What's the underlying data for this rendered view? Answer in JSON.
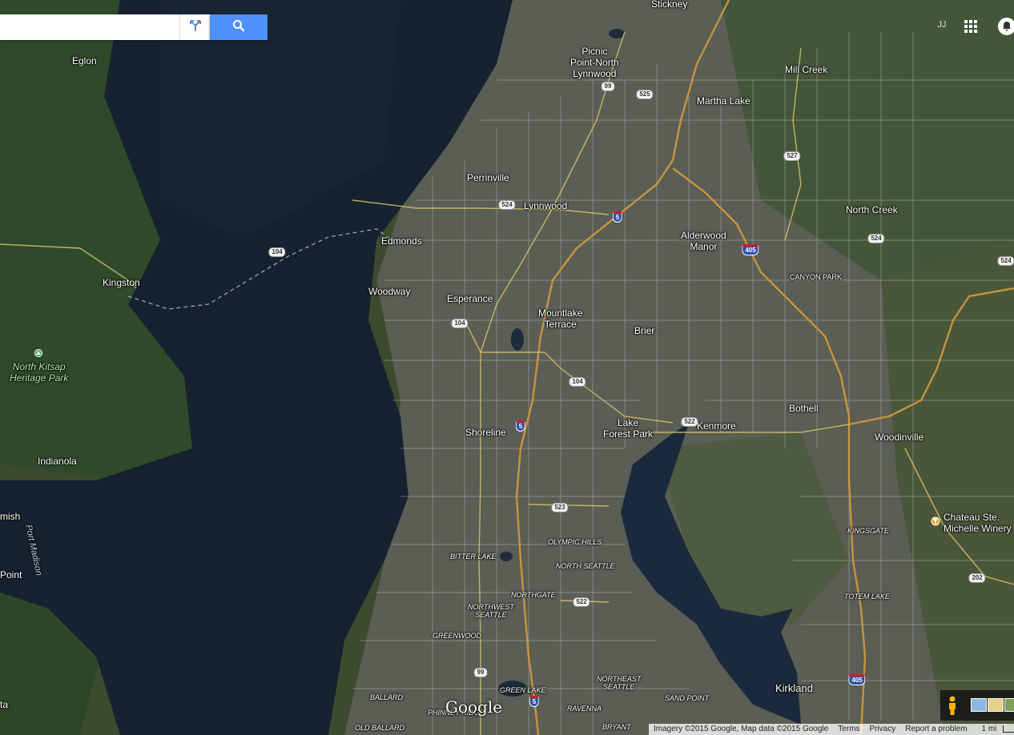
{
  "search": {
    "placeholder": "",
    "value": ""
  },
  "header": {
    "account_initials": "JJ"
  },
  "map": {
    "type": "satellite",
    "places": [
      {
        "name": "Stickney"
      },
      {
        "name": "Eglon"
      },
      {
        "name": "Picnic\nPoint-North\nLynnwood"
      },
      {
        "name": "Mill Creek"
      },
      {
        "name": "Martha Lake"
      },
      {
        "name": "Perrinville"
      },
      {
        "name": "Lynnwood"
      },
      {
        "name": "North Creek"
      },
      {
        "name": "Edmonds"
      },
      {
        "name": "Alderwood\nManor"
      },
      {
        "name": "Kingston"
      },
      {
        "name": "CANYON PARK"
      },
      {
        "name": "Woodway"
      },
      {
        "name": "Esperance"
      },
      {
        "name": "Mountlake\nTerrace"
      },
      {
        "name": "Brier"
      },
      {
        "name": "North Kitsap\nHeritage Park"
      },
      {
        "name": "Bothell"
      },
      {
        "name": "Lake\nForest Park"
      },
      {
        "name": "Kenmore"
      },
      {
        "name": "Shoreline"
      },
      {
        "name": "Woodinville"
      },
      {
        "name": "Indianola"
      },
      {
        "name": "mish"
      },
      {
        "name": "Port Madison"
      },
      {
        "name": "Chateau Ste.\nMichelle Winery"
      },
      {
        "name": "KINGSGATE"
      },
      {
        "name": "OLYMPIC HILLS"
      },
      {
        "name": "BITTER LAKE"
      },
      {
        "name": "NORTH SEATTLE"
      },
      {
        "name": "Point"
      },
      {
        "name": "NORTHGATE"
      },
      {
        "name": "TOTEM LAKE"
      },
      {
        "name": "NORTHWEST\nSEATTLE"
      },
      {
        "name": "GREENWOOD"
      },
      {
        "name": "NORTHEAST\nSEATTLE"
      },
      {
        "name": "Kirkland"
      },
      {
        "name": "GREEN LAKE"
      },
      {
        "name": "BALLARD"
      },
      {
        "name": "SAND POINT"
      },
      {
        "name": "RAVENNA"
      },
      {
        "name": "PHINNEY RIDGE"
      },
      {
        "name": "OLD BALLARD"
      },
      {
        "name": "BRYANT"
      },
      {
        "name": "ta"
      }
    ],
    "shields": [
      {
        "label": "99",
        "kind": "state"
      },
      {
        "label": "525",
        "kind": "state"
      },
      {
        "label": "527",
        "kind": "state"
      },
      {
        "label": "524",
        "kind": "state"
      },
      {
        "label": "5",
        "kind": "interstate"
      },
      {
        "label": "104",
        "kind": "state"
      },
      {
        "label": "524",
        "kind": "state"
      },
      {
        "label": "405",
        "kind": "interstate"
      },
      {
        "label": "524",
        "kind": "state"
      },
      {
        "label": "104",
        "kind": "state"
      },
      {
        "label": "104",
        "kind": "state"
      },
      {
        "label": "5",
        "kind": "interstate"
      },
      {
        "label": "522",
        "kind": "state"
      },
      {
        "label": "523",
        "kind": "state"
      },
      {
        "label": "522",
        "kind": "state"
      },
      {
        "label": "202",
        "kind": "state"
      },
      {
        "label": "99",
        "kind": "state"
      },
      {
        "label": "405",
        "kind": "interstate"
      },
      {
        "label": "5",
        "kind": "interstate"
      }
    ]
  },
  "logo": "Google",
  "footer": {
    "attribution": "Imagery ©2015 Google, Map data ©2015 Google",
    "terms": "Terms",
    "privacy": "Privacy",
    "report": "Report a problem",
    "scale": "1 mi"
  },
  "icons": {
    "directions": "directions-icon",
    "search": "search-icon",
    "apps": "apps-grid-icon",
    "notifications": "notifications-bell-icon",
    "pegman": "pegman-icon",
    "park": "park-tree-icon",
    "poi": "winery-pin-icon"
  }
}
